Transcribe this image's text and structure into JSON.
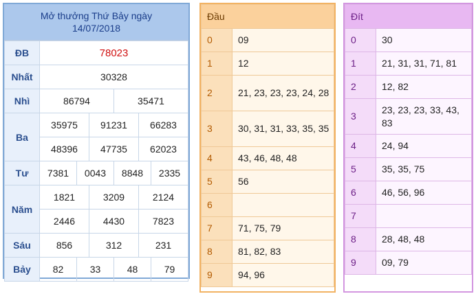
{
  "results": {
    "title_line1": "Mở thưởng Thứ Bảy ngày",
    "title_line2": "14/07/2018",
    "rows": [
      {
        "label": "ĐB",
        "values": [
          "78023"
        ]
      },
      {
        "label": "Nhất",
        "values": [
          "30328"
        ]
      },
      {
        "label": "Nhì",
        "values": [
          "86794",
          "35471"
        ]
      },
      {
        "label": "Ba",
        "values": [
          "35975",
          "91231",
          "66283",
          "48396",
          "47735",
          "62023"
        ]
      },
      {
        "label": "Tư",
        "values": [
          "7381",
          "0043",
          "8848",
          "2335"
        ]
      },
      {
        "label": "Năm",
        "values": [
          "1821",
          "3209",
          "2124",
          "2446",
          "4430",
          "7823"
        ]
      },
      {
        "label": "Sáu",
        "values": [
          "856",
          "312",
          "231"
        ]
      },
      {
        "label": "Bảy",
        "values": [
          "82",
          "33",
          "48",
          "79"
        ]
      }
    ]
  },
  "dau": {
    "header": "Đầu",
    "rows": [
      {
        "k": "0",
        "v": "09"
      },
      {
        "k": "1",
        "v": "12"
      },
      {
        "k": "2",
        "v": "21, 23, 23, 23, 24, 28"
      },
      {
        "k": "3",
        "v": "30, 31, 31, 33, 35, 35"
      },
      {
        "k": "4",
        "v": "43, 46, 48, 48"
      },
      {
        "k": "5",
        "v": "56"
      },
      {
        "k": "6",
        "v": ""
      },
      {
        "k": "7",
        "v": "71, 75, 79"
      },
      {
        "k": "8",
        "v": "81, 82, 83"
      },
      {
        "k": "9",
        "v": "94, 96"
      }
    ]
  },
  "dit": {
    "header": "Đít",
    "rows": [
      {
        "k": "0",
        "v": "30"
      },
      {
        "k": "1",
        "v": "21, 31, 31, 71, 81"
      },
      {
        "k": "2",
        "v": "12, 82"
      },
      {
        "k": "3",
        "v": "23, 23, 23, 33, 43, 83"
      },
      {
        "k": "4",
        "v": "24, 94"
      },
      {
        "k": "5",
        "v": "35, 35, 75"
      },
      {
        "k": "6",
        "v": "46, 56, 96"
      },
      {
        "k": "7",
        "v": ""
      },
      {
        "k": "8",
        "v": "28, 48, 48"
      },
      {
        "k": "9",
        "v": "09, 79"
      }
    ]
  },
  "colors": {
    "results_header_bg": "#acc8ec",
    "special_prize_text": "#d01010",
    "dau_border": "#f2b262",
    "dit_border": "#d396e0"
  }
}
